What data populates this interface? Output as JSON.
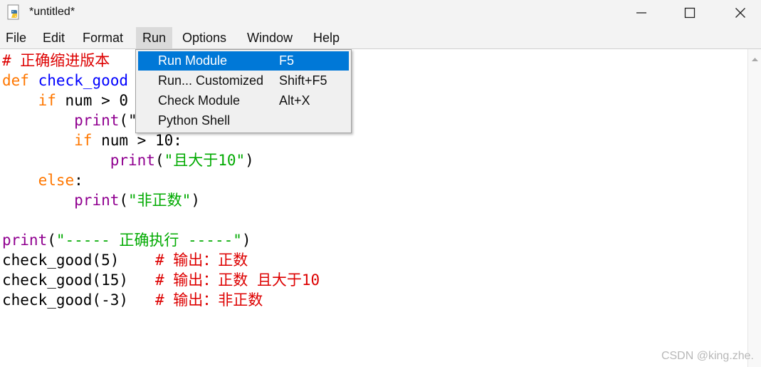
{
  "window": {
    "title": "*untitled*",
    "icons": {
      "app": "python-idle-icon",
      "minimize": "minimize-icon",
      "maximize": "maximize-icon",
      "close": "close-icon"
    }
  },
  "menubar": [
    "File",
    "Edit",
    "Format",
    "Run",
    "Options",
    "Window",
    "Help"
  ],
  "run_menu": [
    {
      "label": "Run Module",
      "accel": "F5"
    },
    {
      "label": "Run... Customized",
      "accel": "Shift+F5"
    },
    {
      "label": "Check Module",
      "accel": "Alt+X"
    },
    {
      "label": "Python Shell",
      "accel": ""
    }
  ],
  "colors": {
    "keyword": "#ff7700",
    "builtin": "#900090",
    "definition": "#0000ff",
    "string": "#00aa00",
    "comment": "#dd0000",
    "menu_highlight": "#0078d7"
  },
  "code": {
    "l1": "# 正确缩进版本",
    "l2_kw": "def",
    "l2_fn": "check_good",
    "l3_kw": "if",
    "l3_rest": " num > 0",
    "l4_fn": "print",
    "l4_rest": "(\"",
    "l5_kw": "if",
    "l5_rest": " num > 10:",
    "l6_fn": "print",
    "l6_open": "(",
    "l6_str": "\"且大于10\"",
    "l6_close": ")",
    "l7_kw": "else",
    "l7_rest": ":",
    "l8_fn": "print",
    "l8_open": "(",
    "l8_str": "\"非正数\"",
    "l8_close": ")",
    "l10_fn": "print",
    "l10_open": "(",
    "l10_str": "\"----- 正确执行 -----\"",
    "l10_close": ")",
    "l11_code": "check_good(5)    ",
    "l11_cm": "# 输出：正数",
    "l12_code": "check_good(15)   ",
    "l12_cm": "# 输出：正数 且大于10",
    "l13_code": "check_good(-3)   ",
    "l13_cm": "# 输出：非正数"
  },
  "watermark": "CSDN @king.zhe."
}
